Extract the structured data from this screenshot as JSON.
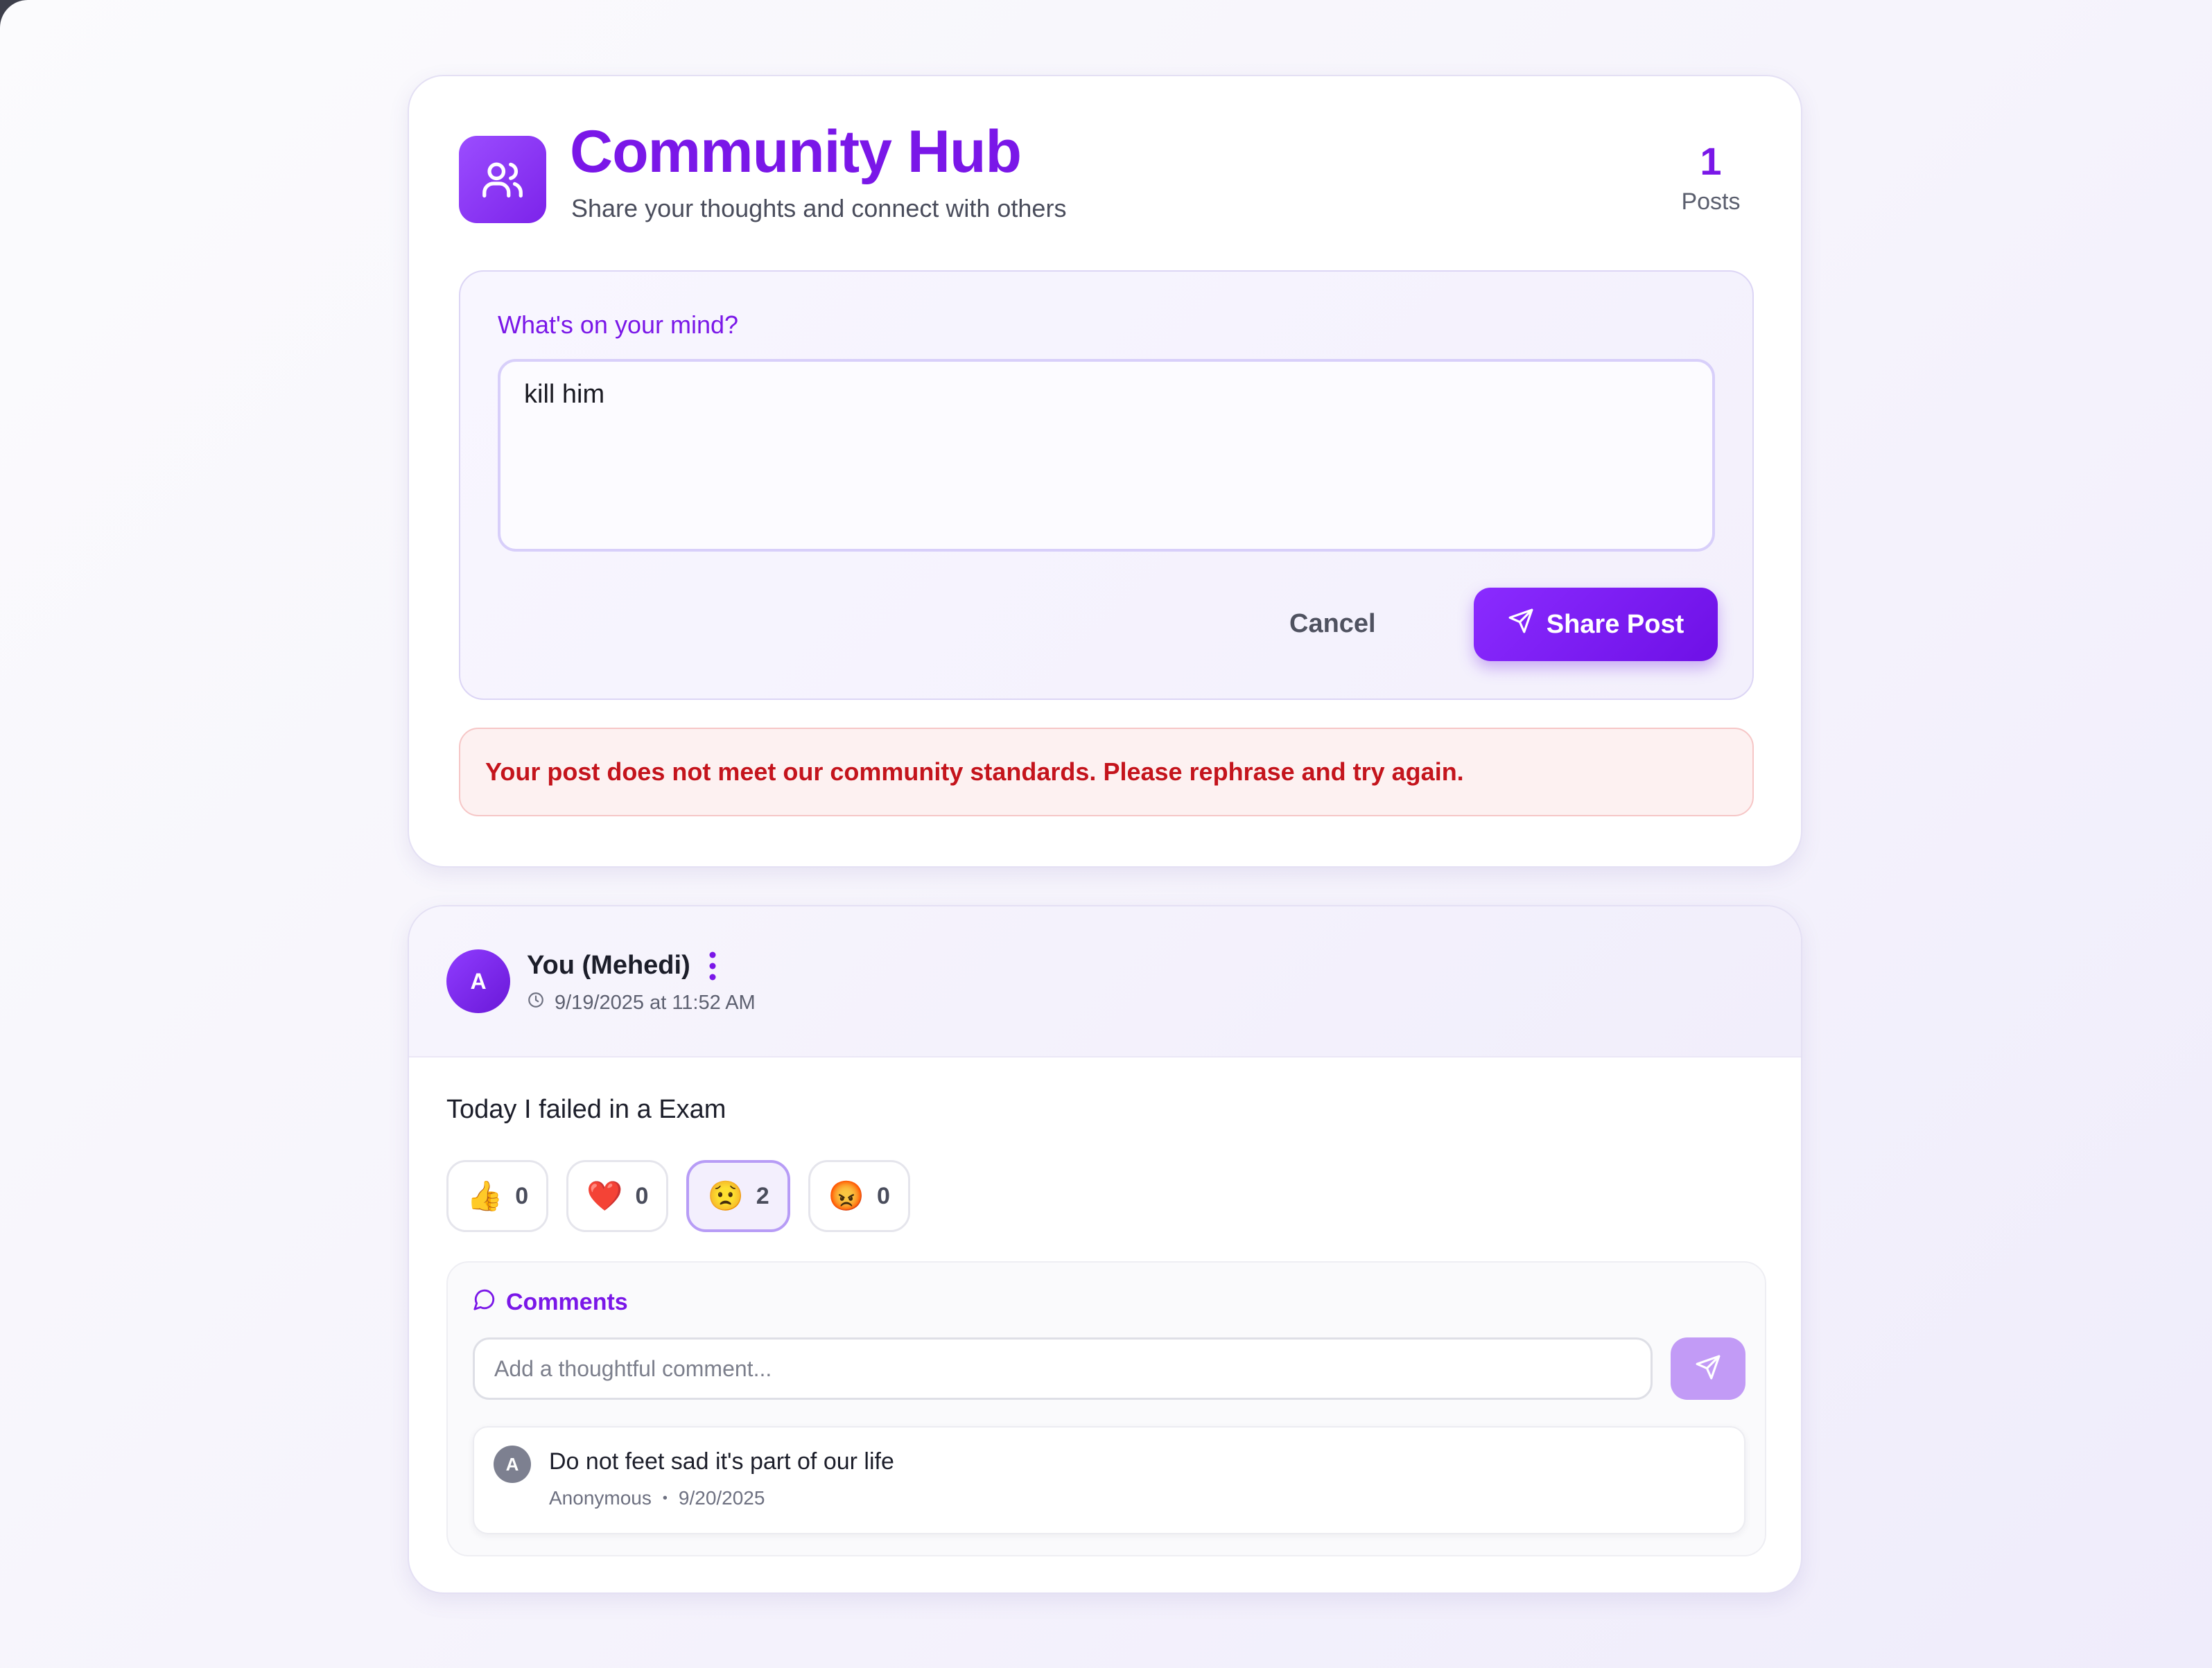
{
  "hub": {
    "title": "Community Hub",
    "subtitle": "Share your thoughts and connect with others",
    "post_count": "1",
    "post_count_label": "Posts",
    "icon": "users-icon",
    "accent_color": "#7a17e8"
  },
  "composer": {
    "label": "What's on your mind?",
    "value": "kill him",
    "cancel_label": "Cancel",
    "share_label": "Share Post",
    "share_icon": "send-icon"
  },
  "error": {
    "message": "Your post does not meet our community standards. Please rephrase and try again.",
    "color": "#c4141c"
  },
  "post": {
    "avatar_initial": "A",
    "author": "You (Mehedi)",
    "timestamp": "9/19/2025 at 11:52 AM",
    "content": "Today I failed in a Exam",
    "reactions": [
      {
        "emoji": "👍",
        "name": "thumbs-up",
        "count": "0",
        "active": false
      },
      {
        "emoji": "❤️",
        "name": "heart",
        "count": "0",
        "active": false
      },
      {
        "emoji": "😟",
        "name": "sad",
        "count": "2",
        "active": true
      },
      {
        "emoji": "😡",
        "name": "angry",
        "count": "0",
        "active": false
      }
    ]
  },
  "comments": {
    "title": "Comments",
    "placeholder": "Add a thoughtful comment...",
    "items": [
      {
        "avatar_initial": "A",
        "text": "Do not feet sad it's part of our life",
        "author": "Anonymous",
        "separator": "•",
        "date": "9/20/2025"
      }
    ]
  }
}
